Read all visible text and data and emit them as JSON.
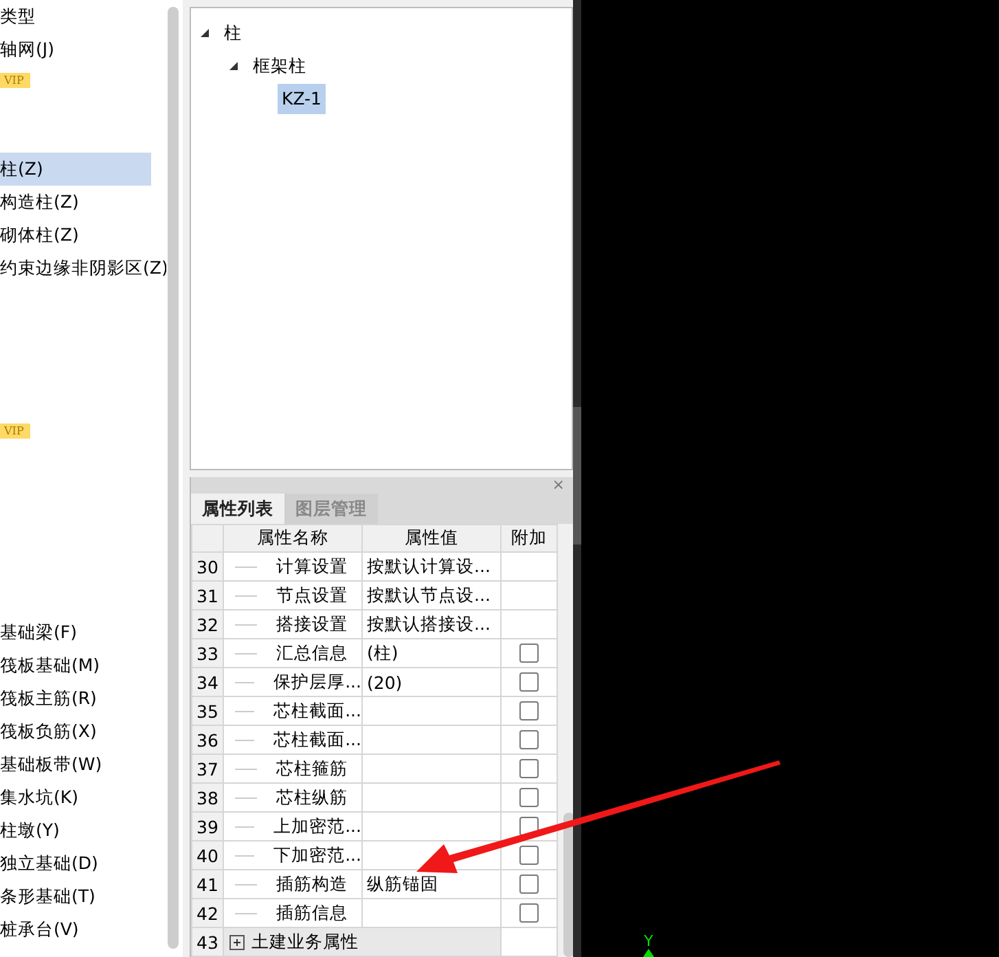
{
  "sidebar": {
    "groups": [
      {
        "items": [
          {
            "label": "类型",
            "selected": false
          },
          {
            "label": "轴网(J)",
            "selected": false
          }
        ],
        "badge": "VIP"
      },
      {
        "items": [
          {
            "label": "柱(Z)",
            "selected": true
          },
          {
            "label": "构造柱(Z)",
            "selected": false
          },
          {
            "label": "砌体柱(Z)",
            "selected": false
          },
          {
            "label": "约束边缘非阴影区(Z)",
            "selected": false
          }
        ]
      },
      {
        "badge": "VIP"
      },
      {
        "items": [
          {
            "label": "基础梁(F)",
            "selected": false
          },
          {
            "label": "筏板基础(M)",
            "selected": false
          },
          {
            "label": "筏板主筋(R)",
            "selected": false
          },
          {
            "label": "筏板负筋(X)",
            "selected": false
          },
          {
            "label": "基础板带(W)",
            "selected": false
          },
          {
            "label": "集水坑(K)",
            "selected": false
          },
          {
            "label": "柱墩(Y)",
            "selected": false
          },
          {
            "label": "独立基础(D)",
            "selected": false
          },
          {
            "label": "条形基础(T)",
            "selected": false
          },
          {
            "label": "桩承台(V)",
            "selected": false
          }
        ]
      }
    ]
  },
  "tree": {
    "nodes": [
      {
        "label": "柱",
        "expanded": true,
        "selected": false,
        "children": [
          {
            "label": "框架柱",
            "expanded": true,
            "selected": false,
            "children": [
              {
                "label": "KZ-1",
                "selected": true
              }
            ]
          }
        ]
      }
    ]
  },
  "properties": {
    "close": "×",
    "tabs": [
      {
        "label": "属性列表",
        "selected": true
      },
      {
        "label": "图层管理",
        "selected": false
      }
    ],
    "columns": [
      "属性名称",
      "属性值",
      "附加"
    ],
    "rows": [
      {
        "kind": "property",
        "num": "30",
        "name": "计算设置",
        "value": "按默认计算设..."
      },
      {
        "kind": "property",
        "num": "31",
        "name": "节点设置",
        "value": "按默认节点设..."
      },
      {
        "kind": "property",
        "num": "32",
        "name": "搭接设置",
        "value": "按默认搭接设..."
      },
      {
        "kind": "property",
        "num": "33",
        "name": "汇总信息",
        "value": "(柱)",
        "checked": false
      },
      {
        "kind": "property",
        "num": "34",
        "name": "保护层厚...",
        "value": "(20)",
        "checked": false
      },
      {
        "kind": "property",
        "num": "35",
        "name": "芯柱截面...",
        "checked": false
      },
      {
        "kind": "property",
        "num": "36",
        "name": "芯柱截面...",
        "checked": false
      },
      {
        "kind": "property",
        "num": "37",
        "name": "芯柱箍筋",
        "checked": false
      },
      {
        "kind": "property",
        "num": "38",
        "name": "芯柱纵筋",
        "checked": false
      },
      {
        "kind": "property",
        "num": "39",
        "name": "上加密范...",
        "checked": false
      },
      {
        "kind": "property",
        "num": "40",
        "name": "下加密范...",
        "checked": false
      },
      {
        "kind": "property",
        "num": "41",
        "name": "插筋构造",
        "value": "纵筋锚固",
        "checked": false
      },
      {
        "kind": "property",
        "num": "42",
        "name": "插筋信息",
        "checked": false
      },
      {
        "kind": "group",
        "num": "43",
        "name": "土建业务属性",
        "expanded": false
      }
    ]
  },
  "canvas": {
    "axis_label": "Y"
  }
}
